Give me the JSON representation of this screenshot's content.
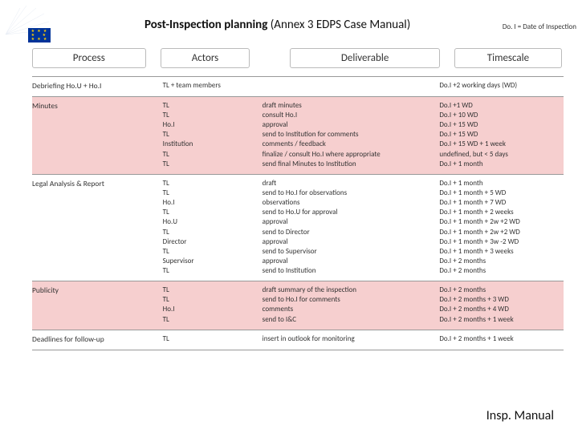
{
  "title_bold": "Post-Inspection planning",
  "title_rest": " (Annex 3 EDPS Case Manual)",
  "doi_note": "Do. I = Date of Inspection",
  "headers": {
    "process": "Process",
    "actors": "Actors",
    "deliverable": "Deliverable",
    "timescale": "Timescale"
  },
  "rows": [
    {
      "process": "Debriefing  Ho.U + Ho.I",
      "actors": [
        "TL + team members"
      ],
      "deliverable": [],
      "timescale": [
        "Do.I +2 working days (WD)"
      ],
      "hl": false
    },
    {
      "process": "Minutes",
      "actors": [
        "TL",
        "TL",
        "Ho.I",
        "TL",
        "Institution",
        "TL",
        "TL"
      ],
      "deliverable": [
        "draft minutes",
        "consult Ho.I",
        "approval",
        "send to Institution for comments",
        "comments / feedback",
        "finalize / consult Ho.I where appropriate",
        "send final Minutes to Institution"
      ],
      "timescale": [
        "Do.I +1 WD",
        "Do.I + 10 WD",
        "Do.I + 15 WD",
        "Do.I + 15 WD",
        "Do.I + 15 WD + 1 week",
        "undefined, but < 5 days",
        "Do.I + 1 month"
      ],
      "hl": true
    },
    {
      "process": "Legal Analysis & Report",
      "actors": [
        "TL",
        "TL",
        "Ho.I",
        "TL",
        "Ho.U",
        "TL",
        "Director",
        "TL",
        "Supervisor",
        "TL"
      ],
      "deliverable": [
        "draft",
        "send to Ho.I for observations",
        "observations",
        "send to Ho.U for approval",
        "approval",
        "send to Director",
        "approval",
        "send to Supervisor",
        "approval",
        "send to Institution"
      ],
      "timescale": [
        "Do.I + 1 month",
        "Do.I + 1 month + 5 WD",
        "Do.I + 1 month + 7 WD",
        "Do.I + 1 month + 2 weeks",
        "Do.I + 1 month + 2w +2 WD",
        "Do.I + 1 month + 2w +2 WD",
        "Do.I + 1 month + 3w -2 WD",
        "Do.I + 1 month + 3 weeks",
        "Do.I + 2 months",
        "Do.I + 2 months"
      ],
      "hl": false
    },
    {
      "process": "Publicity",
      "actors": [
        "TL",
        "TL",
        "Ho.I",
        "TL"
      ],
      "deliverable": [
        "draft summary of the inspection",
        "send to Ho.I for comments",
        "comments",
        "send to I&C"
      ],
      "timescale": [
        "Do.I + 2 months",
        "Do.I + 2 months + 3 WD",
        "Do.I + 2 months + 4 WD",
        "Do.I  + 2 months + 1 week"
      ],
      "hl": true
    },
    {
      "process": "Deadlines for follow-up",
      "actors": [
        "TL"
      ],
      "deliverable": [
        "insert in outlook for monitoring"
      ],
      "timescale": [
        "Do.I + 2 months + 1 week"
      ],
      "hl": false
    }
  ],
  "footer": "Insp. Manual"
}
